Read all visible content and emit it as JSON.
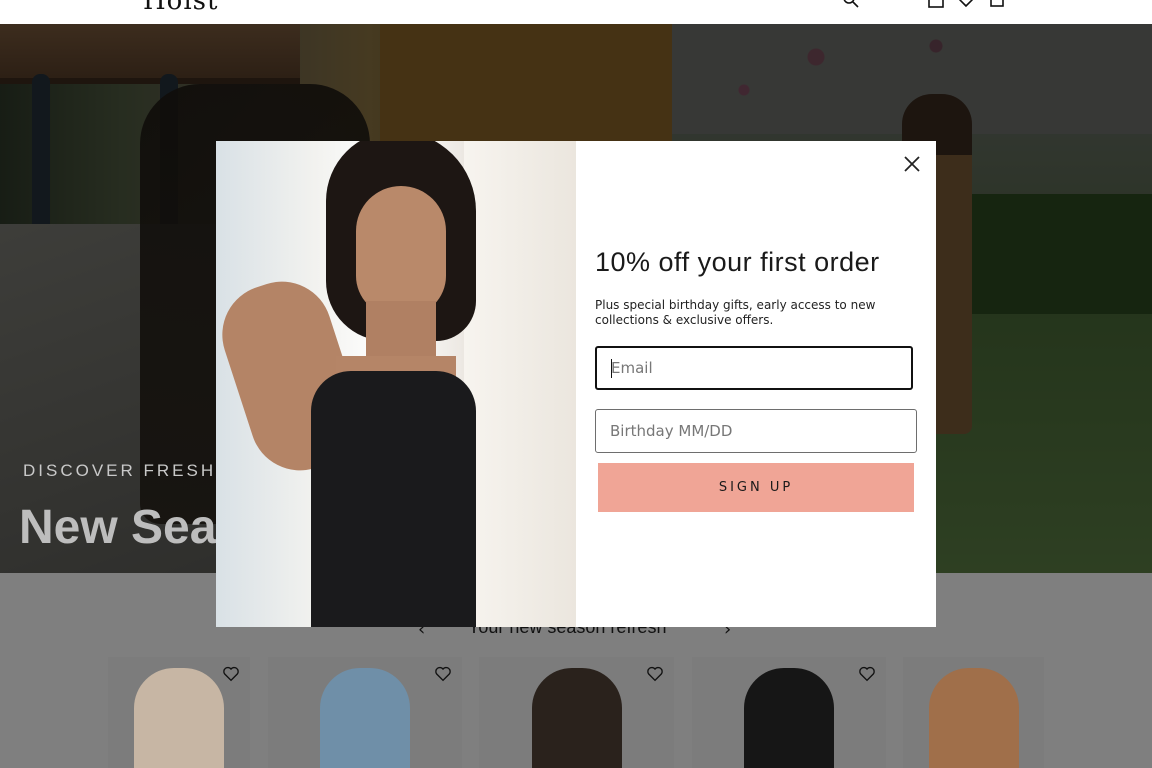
{
  "header": {
    "logo": "Hoist",
    "icons": [
      "search-icon",
      "account-icon",
      "wishlist-icon",
      "cart-icon"
    ]
  },
  "hero": {
    "eyebrow": "DISCOVER FRESH SP",
    "title": "New Sea"
  },
  "section": {
    "title": "Your new season refresh",
    "prev_arrow": "‹",
    "next_arrow": "›"
  },
  "products": [
    {
      "name": "white-top",
      "color": "#c7b6a4"
    },
    {
      "name": "blue-brief",
      "color": "#6f8fa8"
    },
    {
      "name": "black-shaper",
      "color": "#2a221c"
    },
    {
      "name": "black-brief",
      "color": "#161616"
    },
    {
      "name": "nude-shaper",
      "color": "#a06f4a"
    }
  ],
  "modal": {
    "title": "10% off your first order",
    "subtitle": "Plus special birthday gifts, early access to new collections & exclusive offers.",
    "email_placeholder": "Email",
    "birthday_placeholder": "Birthday MM/DD",
    "signup_label": "SIGN UP",
    "button_color": "#f0a596"
  }
}
